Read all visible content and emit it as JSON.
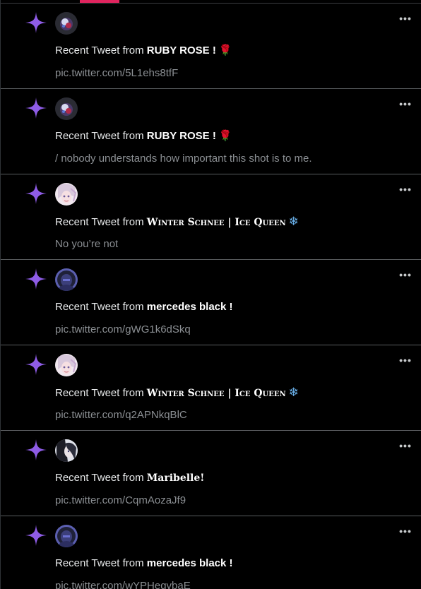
{
  "accent_color": "#e0245e",
  "star_color": "#8e5ce6",
  "notifications": [
    {
      "prefix": "Recent Tweet from ",
      "author": "RUBY ROSE !",
      "author_style": "bold",
      "emoji": "🌹",
      "emoji_kind": "rose",
      "text": "pic.twitter.com/5L1ehs8tfF",
      "avatar": "avatar-ruby-rose"
    },
    {
      "prefix": "Recent Tweet from ",
      "author": "RUBY ROSE !",
      "author_style": "bold",
      "emoji": "🌹",
      "emoji_kind": "rose",
      "text": "/ nobody understands how important this shot is to me.",
      "avatar": "avatar-ruby-rose"
    },
    {
      "prefix": "Recent Tweet from ",
      "author": "Winter Schnee | Ice Queen",
      "author_style": "smallcaps",
      "emoji": "❄",
      "emoji_kind": "snow",
      "text": "No you’re not",
      "avatar": "avatar-winter-schnee"
    },
    {
      "prefix": "Recent Tweet from ",
      "author": "mercedes black !",
      "author_style": "bold",
      "emoji": "",
      "emoji_kind": "",
      "text": "pic.twitter.com/gWG1k6dSkq",
      "avatar": "avatar-mercedes-black"
    },
    {
      "prefix": "Recent Tweet from ",
      "author": "Winter Schnee | Ice Queen",
      "author_style": "smallcaps",
      "emoji": "❄",
      "emoji_kind": "snow",
      "text": "pic.twitter.com/q2APNkqBlC",
      "avatar": "avatar-winter-schnee"
    },
    {
      "prefix": "Recent Tweet from ",
      "author": "Maribelle!",
      "author_style": "serif",
      "emoji": "",
      "emoji_kind": "",
      "text": "pic.twitter.com/CqmAozaJf9",
      "avatar": "avatar-maribelle"
    },
    {
      "prefix": "Recent Tweet from ",
      "author": "mercedes black !",
      "author_style": "bold",
      "emoji": "",
      "emoji_kind": "",
      "text": "pic.twitter.com/wYPHegvbaE",
      "avatar": "avatar-mercedes-black"
    }
  ],
  "more_label": "•••"
}
